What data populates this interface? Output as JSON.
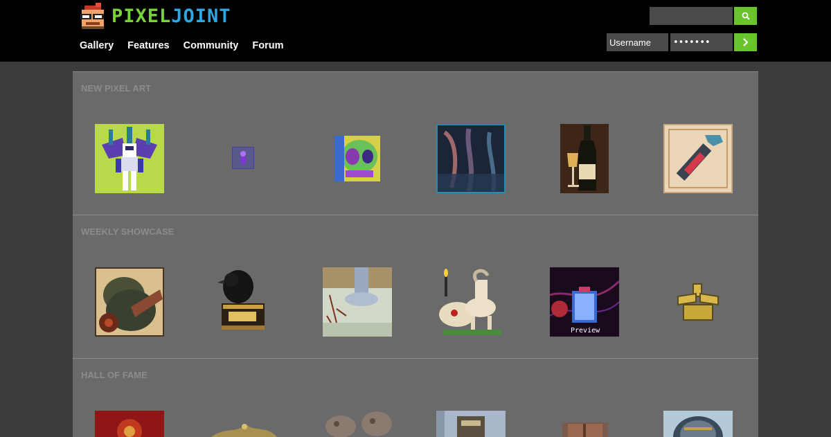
{
  "header": {
    "logo": {
      "part1": "PIXEL",
      "part2": "JOINT"
    },
    "nav": [
      "Gallery",
      "Features",
      "Community",
      "Forum"
    ],
    "search": {
      "value": "",
      "button_icon": "search-icon"
    },
    "login": {
      "username_placeholder": "Username",
      "password_mask": "•••••••",
      "submit_icon": "chevron-right-icon"
    }
  },
  "sections": [
    {
      "title": "NEW PIXEL ART"
    },
    {
      "title": "WEEKLY SHOWCASE"
    },
    {
      "title": "HALL OF FAME"
    }
  ],
  "thumbnail_overlay": {
    "preview_label": "Preview"
  },
  "colors": {
    "page_bg": "#3b3b3b",
    "header_bg": "#000000",
    "panel_bg": "#6a6a6a",
    "section_title": "#8c8c8c",
    "accent_green": "#69c42d",
    "logo_green": "#78d33a",
    "logo_blue": "#2ea6e0"
  }
}
